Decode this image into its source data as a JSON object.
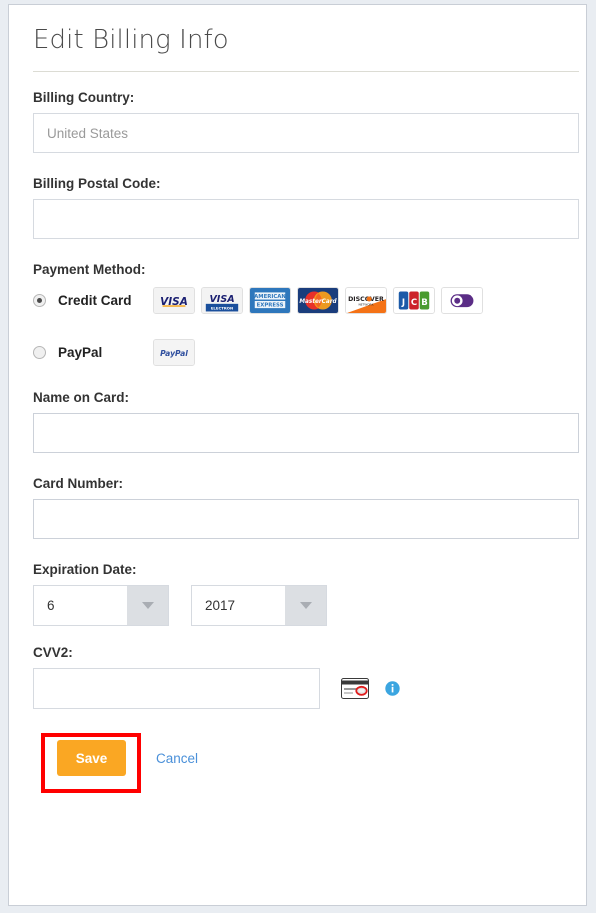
{
  "form": {
    "title": "Edit Billing Info",
    "fields": {
      "billing_country": {
        "label": "Billing Country:",
        "value": "",
        "placeholder": "United States"
      },
      "billing_postal_code": {
        "label": "Billing Postal Code:",
        "value": "",
        "placeholder": ""
      },
      "payment_method": {
        "label": "Payment Method:",
        "options": [
          {
            "label": "Credit Card",
            "selected": true,
            "logos": [
              "visa-logo",
              "visa-electron-logo",
              "american-express-logo",
              "mastercard-logo",
              "discover-logo",
              "jcb-logo",
              "diners-club-logo"
            ]
          },
          {
            "label": "PayPal",
            "selected": false,
            "logos": [
              "paypal-logo"
            ]
          }
        ]
      },
      "name_on_card": {
        "label": "Name on Card:",
        "value": "",
        "placeholder": ""
      },
      "card_number": {
        "label": "Card Number:",
        "value": "",
        "placeholder": ""
      },
      "expiration_date": {
        "label": "Expiration Date:",
        "month": "6",
        "year": "2017"
      },
      "cvv2": {
        "label": "CVV2:",
        "value": "",
        "placeholder": "",
        "card_icon": "cvv-card-back-icon",
        "info_icon": "info-icon"
      }
    },
    "actions": {
      "save_label": "Save",
      "cancel_label": "Cancel"
    }
  },
  "colors": {
    "page_background": "#e9edf2",
    "panel_background": "#ffffff",
    "panel_border": "#c9ced6",
    "title_text": "#4a4a4a",
    "label_text": "#333333",
    "input_border": "#d6dae0",
    "placeholder_text": "#9a9a9a",
    "save_button": "#faa723",
    "save_button_text": "#ffffff",
    "cancel_link": "#4a90d9",
    "annotation_box": "#ff0000",
    "select_button": "#dcdfe3",
    "info_icon": "#3ba5e0"
  }
}
